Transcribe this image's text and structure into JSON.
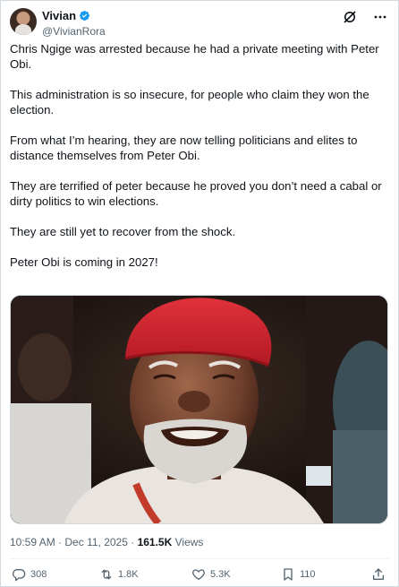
{
  "author": {
    "display_name": "Vivian",
    "handle": "@VivianRora",
    "verified": true,
    "verified_color": "#1d9bf0"
  },
  "tweet": {
    "paragraphs": [
      "Chris Ngige was arrested because he had a private meeting with Peter Obi.",
      "This administration is so insecure, for people who claim they won the election.",
      "From what I’m hearing, they are now telling politicians and elites to distance themselves from Peter Obi.",
      "They are terrified of peter because he proved you don’t need a cabal or dirty politics to win elections.",
      "They are still yet to recover from the shock.",
      "Peter Obi is coming in 2027!"
    ]
  },
  "meta": {
    "time": "10:59 AM",
    "separator": "·",
    "date": "Dec 11, 2025",
    "separator2": "·",
    "views_count": "161.5K",
    "views_label": "Views"
  },
  "actions": {
    "replies": "308",
    "reposts": "1.8K",
    "likes": "5.3K",
    "bookmarks": "110"
  },
  "icons": {
    "header": [
      "grok-icon",
      "more-icon"
    ],
    "actions": [
      "reply-icon",
      "repost-icon",
      "like-icon",
      "bookmark-icon",
      "share-icon"
    ]
  },
  "colors": {
    "text_primary": "#0f1419",
    "text_secondary": "#536471",
    "border": "#cfd9de",
    "verified": "#1d9bf0"
  }
}
